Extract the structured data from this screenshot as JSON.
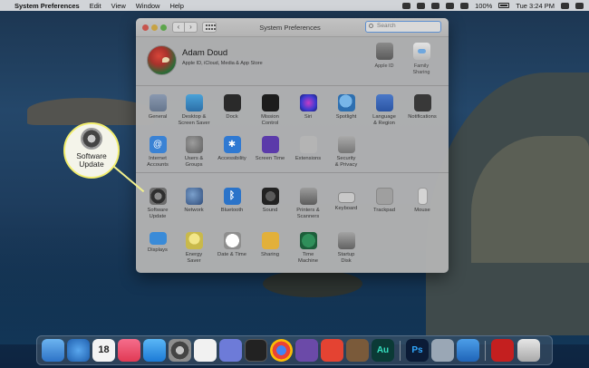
{
  "menubar": {
    "apple": "",
    "app_name": "System Preferences",
    "menus": [
      "Edit",
      "View",
      "Window",
      "Help"
    ],
    "battery": "100%",
    "clock": "Tue 3:24 PM"
  },
  "window": {
    "title": "System Preferences",
    "search_placeholder": "Search",
    "nav_back": "‹",
    "nav_forward": "›"
  },
  "account": {
    "name": "Adam Doud",
    "subtitle": "Apple ID, iCloud, Media & App Store",
    "apple_id_label": "Apple ID",
    "family_label": "Family\nSharing"
  },
  "prefs": {
    "general": "General",
    "desktop": "Desktop &\nScreen Saver",
    "dock": "Dock",
    "mission": "Mission\nControl",
    "siri": "Siri",
    "spotlight": "Spotlight",
    "language": "Language\n& Region",
    "notifications": "Notifications",
    "internet": "Internet\nAccounts",
    "users": "Users &\nGroups",
    "accessibility": "Accessibility",
    "screentime": "Screen Time",
    "extensions": "Extensions",
    "security": "Security\n& Privacy",
    "swupdate": "Software\nUpdate",
    "network": "Network",
    "bluetooth": "Bluetooth",
    "sound": "Sound",
    "printers": "Printers &\nScanners",
    "keyboard": "Keyboard",
    "trackpad": "Trackpad",
    "mouse": "Mouse",
    "displays": "Displays",
    "energy": "Energy\nSaver",
    "datetime": "Date & Time",
    "sharing": "Sharing",
    "timemachine": "Time\nMachine",
    "startup": "Startup\nDisk"
  },
  "callout": {
    "label": "Software\nUpdate"
  },
  "dock": {
    "calendar_day": "18",
    "audition": "Au",
    "photoshop": "Ps"
  },
  "colors": {
    "callout_border": "#f2ee6e",
    "search_focus": "#5d8fd0"
  }
}
